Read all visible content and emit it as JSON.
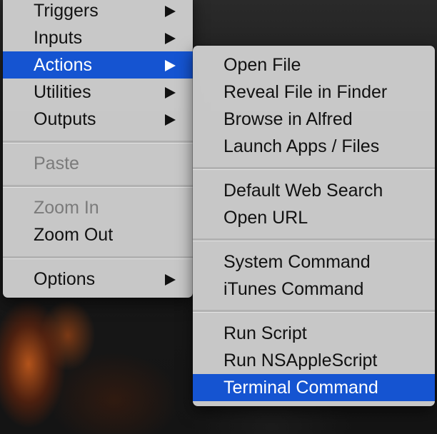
{
  "main_menu": {
    "items": [
      {
        "label": "Triggers",
        "has_submenu": true,
        "enabled": true,
        "selected": false
      },
      {
        "label": "Inputs",
        "has_submenu": true,
        "enabled": true,
        "selected": false
      },
      {
        "label": "Actions",
        "has_submenu": true,
        "enabled": true,
        "selected": true
      },
      {
        "label": "Utilities",
        "has_submenu": true,
        "enabled": true,
        "selected": false
      },
      {
        "label": "Outputs",
        "has_submenu": true,
        "enabled": true,
        "selected": false
      },
      {
        "label": "Paste",
        "has_submenu": false,
        "enabled": false,
        "selected": false
      },
      {
        "label": "Zoom In",
        "has_submenu": false,
        "enabled": false,
        "selected": false
      },
      {
        "label": "Zoom Out",
        "has_submenu": false,
        "enabled": true,
        "selected": false
      },
      {
        "label": "Options",
        "has_submenu": true,
        "enabled": true,
        "selected": false
      }
    ]
  },
  "actions_submenu": {
    "items": [
      {
        "label": "Open File",
        "selected": false
      },
      {
        "label": "Reveal File in Finder",
        "selected": false
      },
      {
        "label": "Browse in Alfred",
        "selected": false
      },
      {
        "label": "Launch Apps / Files",
        "selected": false
      },
      {
        "label": "Default Web Search",
        "selected": false
      },
      {
        "label": "Open URL",
        "selected": false
      },
      {
        "label": "System Command",
        "selected": false
      },
      {
        "label": "iTunes Command",
        "selected": false
      },
      {
        "label": "Run Script",
        "selected": false
      },
      {
        "label": "Run NSAppleScript",
        "selected": false
      },
      {
        "label": "Terminal Command",
        "selected": true
      }
    ]
  },
  "colors": {
    "menu_background": "#cdcdcd",
    "selection": "#1554d1",
    "text": "#111111",
    "disabled_text": "#7b7b7b"
  }
}
